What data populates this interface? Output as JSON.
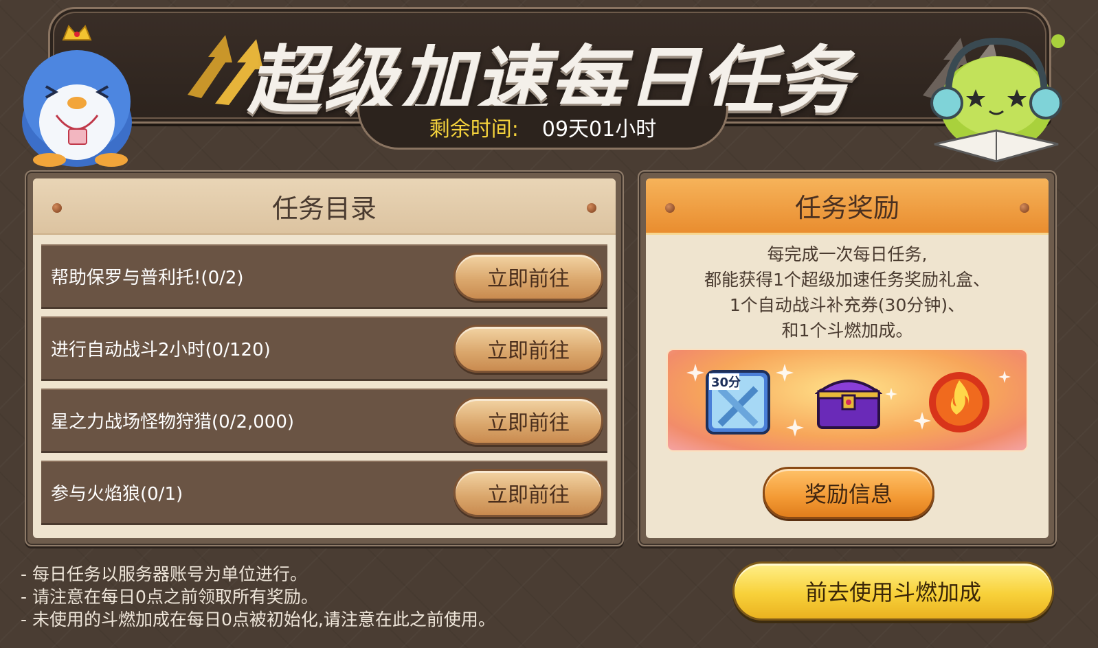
{
  "header": {
    "title": "超级加速每日任务",
    "timer_label": "剩余时间:",
    "timer_value": "09天01小时"
  },
  "tasks_panel": {
    "title": "任务目录",
    "tasks": [
      {
        "text": "帮助保罗与普利托!(0/2)",
        "button": "立即前往"
      },
      {
        "text": "进行自动战斗2小时(0/120)",
        "button": "立即前往"
      },
      {
        "text": "星之力战场怪物狩猎(0/2,000)",
        "button": "立即前往"
      },
      {
        "text": "参与火焰狼(0/1)",
        "button": "立即前往"
      }
    ]
  },
  "reward_panel": {
    "title": "任务奖励",
    "description": [
      "每完成一次每日任务,",
      "都能获得1个超级加速任务奖励礼盒、",
      "1个自动战斗补充券(30分钟)、",
      "和1个斗燃加成。"
    ],
    "items": [
      {
        "icon": "auto-battle-ticket-icon",
        "label": "30分"
      },
      {
        "icon": "treasure-chest-icon"
      },
      {
        "icon": "burning-buff-icon"
      }
    ],
    "info_button": "奖励信息"
  },
  "notes": [
    "- 每日任务以服务器账号为单位进行。",
    "- 请注意在每日0点之前领取所有奖励。",
    "- 未使用的斗燃加成在每日0点被初始化,请注意在此之前使用。"
  ],
  "use_button": "前去使用斗燃加成",
  "colors": {
    "background": "#4a3d33",
    "timer_label": "#f5d33c",
    "reward_header": "#e98d2f",
    "use_button": "#f8d13a"
  }
}
